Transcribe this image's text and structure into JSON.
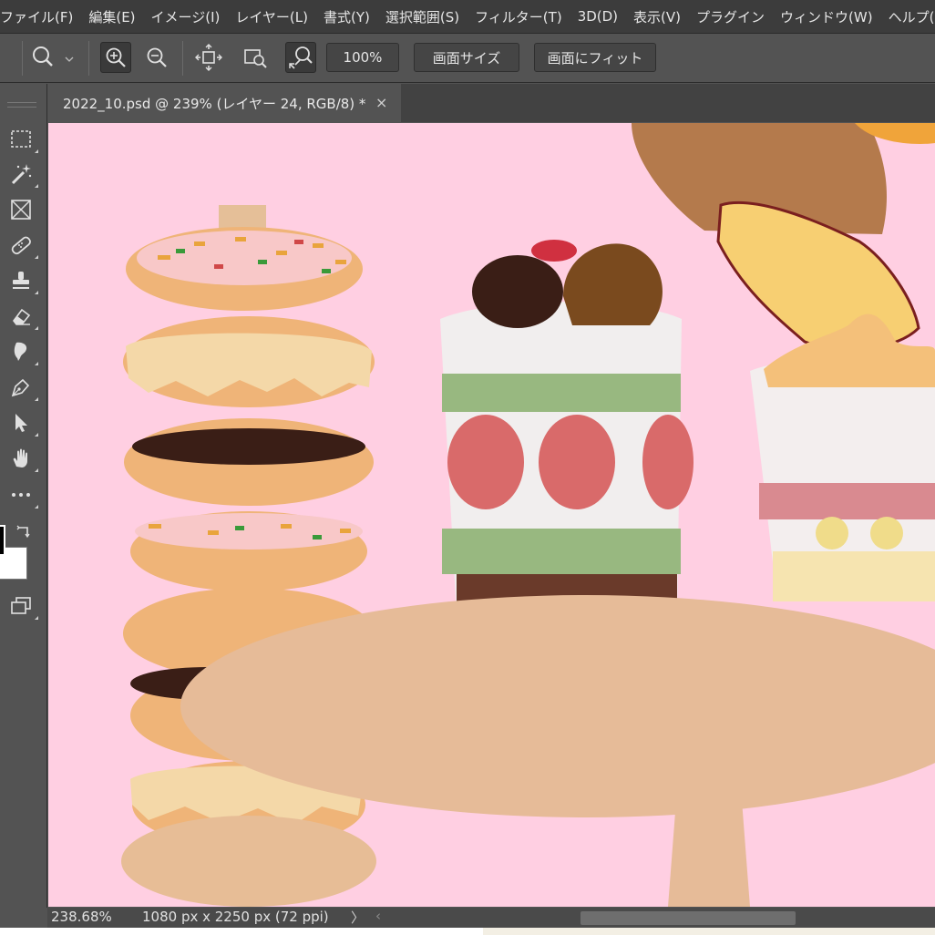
{
  "menu": [
    {
      "label": "ファイル(F)"
    },
    {
      "label": "編集(E)"
    },
    {
      "label": "イメージ(I)"
    },
    {
      "label": "レイヤー(L)"
    },
    {
      "label": "書式(Y)"
    },
    {
      "label": "選択範囲(S)"
    },
    {
      "label": "フィルター(T)"
    },
    {
      "label": "3D(D)"
    },
    {
      "label": "表示(V)"
    },
    {
      "label": "プラグイン"
    },
    {
      "label": "ウィンドウ(W)"
    },
    {
      "label": "ヘルプ(H)"
    }
  ],
  "options": {
    "zoom_value": "100%",
    "canvas_size_label": "画面サイズ",
    "fit_screen_label": "画面にフィット"
  },
  "tab": {
    "title": "2022_10.psd @ 239% (レイヤー 24, RGB/8) *",
    "close": "×"
  },
  "status": {
    "zoom": "238.68%",
    "doc_size": "1080 px x 2250 px (72 ppi)",
    "arrow": "〉",
    "scroll_left": "‹"
  },
  "icons": {
    "zoom_tool": "magnifier-icon",
    "zoom_in": "zoom-in-icon",
    "zoom_out": "zoom-out-icon",
    "fit": "fit-window-icon",
    "resize_windows": "resize-windows-icon",
    "scrubby_zoom": "scrubby-zoom-icon"
  },
  "colors": {
    "canvas": "#ffcfe2",
    "accent": "#3c3c3c"
  }
}
